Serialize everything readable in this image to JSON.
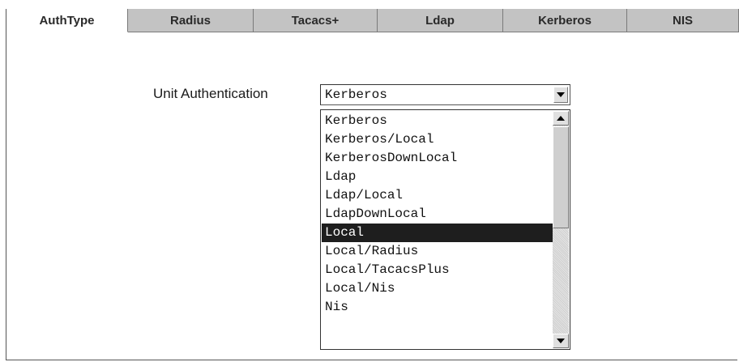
{
  "tabs": [
    "AuthType",
    "Radius",
    "Tacacs+",
    "Ldap",
    "Kerberos",
    "NIS"
  ],
  "active_tab": "AuthType",
  "field_label": "Unit Authentication",
  "combo_value": "Kerberos",
  "options": [
    "Kerberos",
    "Kerberos/Local",
    "KerberosDownLocal",
    "Ldap",
    "Ldap/Local",
    "LdapDownLocal",
    "Local",
    "Local/Radius",
    "Local/TacacsPlus",
    "Local/Nis",
    "Nis"
  ],
  "selected_option": "Local",
  "icons": {
    "dropdown": "chevron-down-icon",
    "scroll_up": "chevron-up-icon",
    "scroll_down": "chevron-down-icon"
  }
}
